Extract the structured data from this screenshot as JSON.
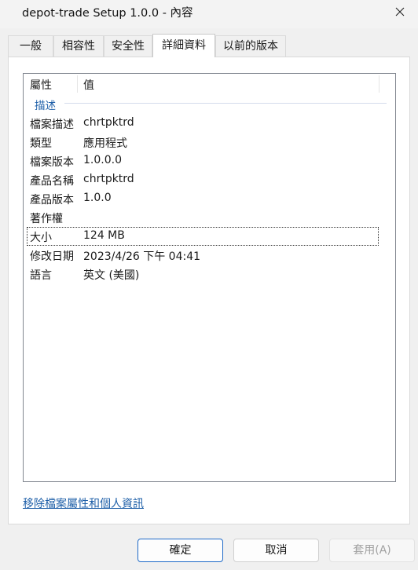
{
  "window": {
    "title": "depot-trade Setup 1.0.0 - 內容"
  },
  "tabs": [
    {
      "label": "一般"
    },
    {
      "label": "相容性"
    },
    {
      "label": "安全性"
    },
    {
      "label": "詳細資料"
    },
    {
      "label": "以前的版本"
    }
  ],
  "details": {
    "header": {
      "property": "屬性",
      "value": "值"
    },
    "group": "描述",
    "rows": [
      {
        "key": "檔案描述",
        "value": "chrtpktrd"
      },
      {
        "key": "類型",
        "value": "應用程式"
      },
      {
        "key": "檔案版本",
        "value": "1.0.0.0"
      },
      {
        "key": "產品名稱",
        "value": "chrtpktrd"
      },
      {
        "key": "產品版本",
        "value": "1.0.0"
      },
      {
        "key": "著作權",
        "value": ""
      },
      {
        "key": "大小",
        "value": "124 MB"
      },
      {
        "key": "修改日期",
        "value": "2023/4/26 下午 04:41"
      },
      {
        "key": "語言",
        "value": "英文 (美國)"
      }
    ],
    "selected_row": "大小"
  },
  "link": {
    "label": "移除檔案屬性和個人資訊"
  },
  "buttons": {
    "ok": "確定",
    "cancel": "取消",
    "apply": "套用(A)"
  },
  "colors": {
    "link": "#1e5fa8",
    "primary_border": "#1f6ac8"
  }
}
